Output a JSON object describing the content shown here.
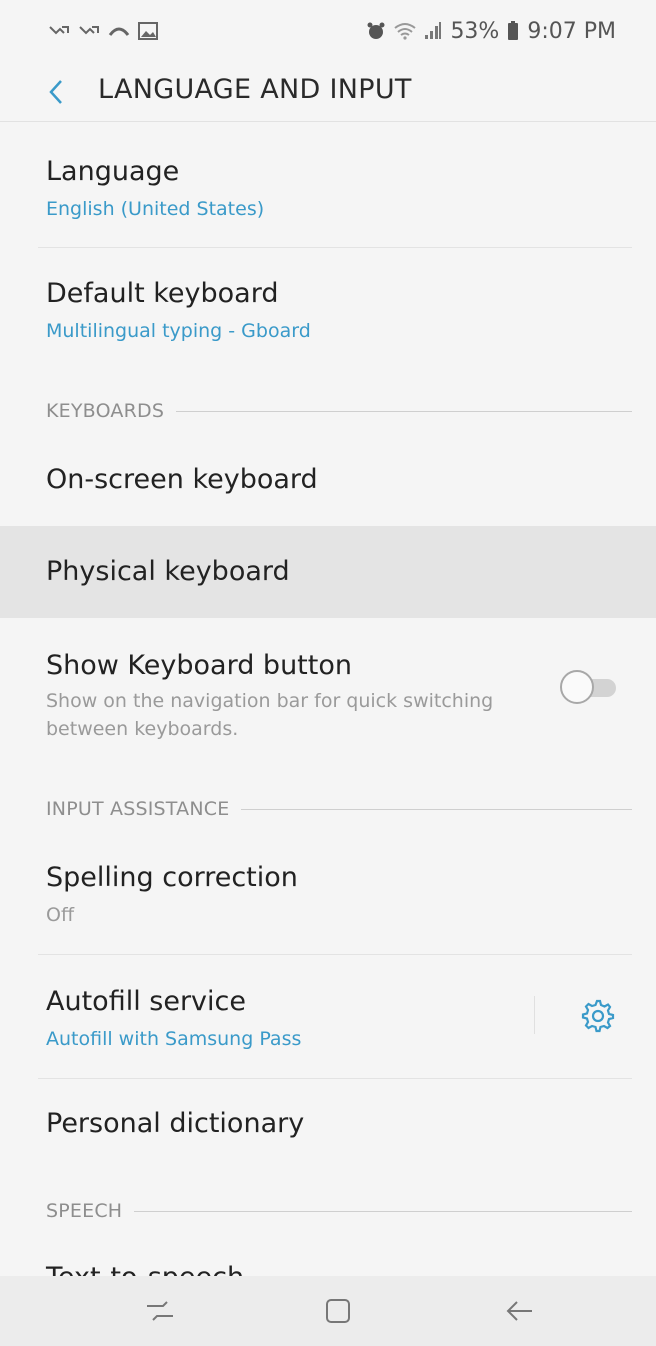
{
  "status_bar": {
    "battery": "53%",
    "time": "9:07 PM",
    "left_icons": [
      "missed-call-icon",
      "missed-call-icon",
      "voicemail-icon",
      "image-icon"
    ],
    "right_icons": [
      "alarm-icon",
      "wifi-icon",
      "signal-icon",
      "battery-icon"
    ]
  },
  "header": {
    "title": "LANGUAGE AND INPUT"
  },
  "items": {
    "language": {
      "title": "Language",
      "subtitle": "English (United States)"
    },
    "default_keyboard": {
      "title": "Default keyboard",
      "subtitle": "Multilingual typing - Gboard"
    },
    "onscreen_keyboard": {
      "title": "On-screen keyboard"
    },
    "physical_keyboard": {
      "title": "Physical keyboard"
    },
    "show_keyboard_button": {
      "title": "Show Keyboard button",
      "subtitle_line1": "Show on the navigation bar for quick switching",
      "subtitle_line2": "between keyboards.",
      "enabled": false
    },
    "spelling_correction": {
      "title": "Spelling correction",
      "subtitle": "Off"
    },
    "autofill_service": {
      "title": "Autofill service",
      "subtitle": "Autofill with Samsung Pass"
    },
    "personal_dictionary": {
      "title": "Personal dictionary"
    },
    "text_to_speech": {
      "title": "Text-to-speech"
    }
  },
  "sections": {
    "keyboards": "KEYBOARDS",
    "input_assistance": "INPUT ASSISTANCE",
    "speech": "SPEECH"
  },
  "colors": {
    "accent": "#3a9ac9",
    "background": "#f5f5f5",
    "highlight": "#e4e4e4"
  }
}
